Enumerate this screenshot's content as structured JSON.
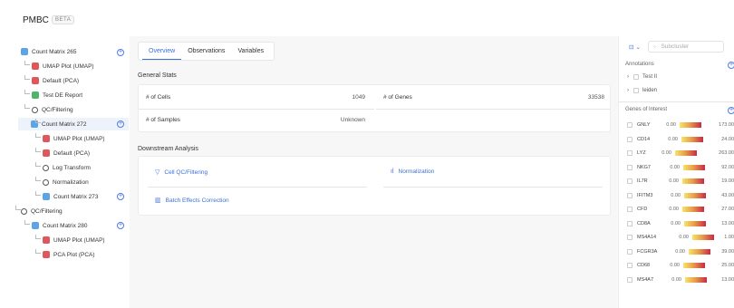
{
  "app": {
    "title": "PMBC",
    "badge": "BETA"
  },
  "tree": [
    {
      "label": "Count Matrix 265",
      "icon": "matrix-icon",
      "type": "matrix"
    },
    {
      "label": "UMAP Plot (UMAP)",
      "icon": "plot-icon",
      "type": "plot"
    },
    {
      "label": "Default (PCA)",
      "icon": "plot-icon",
      "type": "plot"
    },
    {
      "label": "Test DE Report",
      "icon": "report-icon",
      "type": "report"
    },
    {
      "label": "QC/Filtering",
      "icon": "gear-icon",
      "type": "process"
    },
    {
      "label": "Count Matrix 272",
      "icon": "matrix-icon",
      "type": "matrix"
    },
    {
      "label": "UMAP Plot (UMAP)",
      "icon": "plot-icon",
      "type": "plot"
    },
    {
      "label": "Default (PCA)",
      "icon": "plot-icon",
      "type": "plot"
    },
    {
      "label": "Log Transform",
      "icon": "gear-icon",
      "type": "process"
    },
    {
      "label": "Normalization",
      "icon": "gear-icon",
      "type": "process"
    },
    {
      "label": "Count Matrix 273",
      "icon": "matrix-icon",
      "type": "matrix"
    },
    {
      "label": "QC/Filtering",
      "icon": "gear-icon",
      "type": "process"
    },
    {
      "label": "Count Matrix 280",
      "icon": "matrix-icon",
      "type": "matrix"
    },
    {
      "label": "UMAP Plot (UMAP)",
      "icon": "plot-icon",
      "type": "plot"
    },
    {
      "label": "PCA Plot (PCA)",
      "icon": "plot-icon",
      "type": "plot"
    }
  ],
  "tabs": [
    {
      "label": "Overview",
      "active": true
    },
    {
      "label": "Observations",
      "active": false
    },
    {
      "label": "Variables",
      "active": false
    }
  ],
  "general_stats": {
    "title": "General Stats",
    "cells_label": "# of Cells",
    "cells_value": "1049",
    "genes_label": "# of Genes",
    "genes_value": "33538",
    "samples_label": "# of Samples",
    "samples_value": "Unknown"
  },
  "downstream": {
    "title": "Downstream Analysis",
    "qc": "Cell QC/Filtering",
    "normalization": "Normalization",
    "batch": "Batch Effects Correction"
  },
  "right_panel": {
    "subcluster": "Subcluster",
    "annotations_title": "Annotations",
    "annotations": [
      "Test II",
      "leiden"
    ],
    "genes_title": "Genes of Interest",
    "genes": [
      {
        "name": "GNLY",
        "min": "0.00",
        "max": "173.00"
      },
      {
        "name": "CD14",
        "min": "0.00",
        "max": "24.00"
      },
      {
        "name": "LYZ",
        "min": "0.00",
        "max": "263.00"
      },
      {
        "name": "NKG7",
        "min": "0.00",
        "max": "92.00"
      },
      {
        "name": "IL7R",
        "min": "0.00",
        "max": "19.00"
      },
      {
        "name": "IFITM3",
        "min": "0.00",
        "max": "43.00"
      },
      {
        "name": "CFD",
        "min": "0.00",
        "max": "27.00"
      },
      {
        "name": "CD8A",
        "min": "0.00",
        "max": "13.00"
      },
      {
        "name": "MS4A14",
        "min": "0.00",
        "max": "1.00"
      },
      {
        "name": "FCGR3A",
        "min": "0.00",
        "max": "39.00"
      },
      {
        "name": "CD68",
        "min": "0.00",
        "max": "25.00"
      },
      {
        "name": "MS4A7",
        "min": "0.00",
        "max": "13.00"
      }
    ]
  },
  "colors": {
    "accent": "#3b6fd9",
    "matrix": "#5ba4e6",
    "plot": "#e0575b",
    "report": "#4fb56b"
  }
}
